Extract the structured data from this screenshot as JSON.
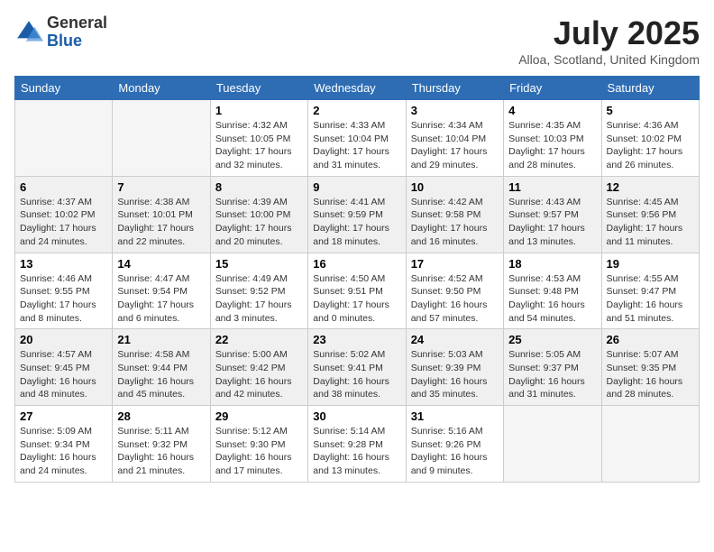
{
  "header": {
    "logo": {
      "general": "General",
      "blue": "Blue"
    },
    "title": "July 2025",
    "location": "Alloa, Scotland, United Kingdom"
  },
  "weekdays": [
    "Sunday",
    "Monday",
    "Tuesday",
    "Wednesday",
    "Thursday",
    "Friday",
    "Saturday"
  ],
  "weeks": [
    [
      {
        "day": "",
        "empty": true
      },
      {
        "day": "",
        "empty": true
      },
      {
        "day": "1",
        "sunrise": "4:32 AM",
        "sunset": "10:05 PM",
        "daylight": "17 hours and 32 minutes."
      },
      {
        "day": "2",
        "sunrise": "4:33 AM",
        "sunset": "10:04 PM",
        "daylight": "17 hours and 31 minutes."
      },
      {
        "day": "3",
        "sunrise": "4:34 AM",
        "sunset": "10:04 PM",
        "daylight": "17 hours and 29 minutes."
      },
      {
        "day": "4",
        "sunrise": "4:35 AM",
        "sunset": "10:03 PM",
        "daylight": "17 hours and 28 minutes."
      },
      {
        "day": "5",
        "sunrise": "4:36 AM",
        "sunset": "10:02 PM",
        "daylight": "17 hours and 26 minutes."
      }
    ],
    [
      {
        "day": "6",
        "sunrise": "4:37 AM",
        "sunset": "10:02 PM",
        "daylight": "17 hours and 24 minutes."
      },
      {
        "day": "7",
        "sunrise": "4:38 AM",
        "sunset": "10:01 PM",
        "daylight": "17 hours and 22 minutes."
      },
      {
        "day": "8",
        "sunrise": "4:39 AM",
        "sunset": "10:00 PM",
        "daylight": "17 hours and 20 minutes."
      },
      {
        "day": "9",
        "sunrise": "4:41 AM",
        "sunset": "9:59 PM",
        "daylight": "17 hours and 18 minutes."
      },
      {
        "day": "10",
        "sunrise": "4:42 AM",
        "sunset": "9:58 PM",
        "daylight": "17 hours and 16 minutes."
      },
      {
        "day": "11",
        "sunrise": "4:43 AM",
        "sunset": "9:57 PM",
        "daylight": "17 hours and 13 minutes."
      },
      {
        "day": "12",
        "sunrise": "4:45 AM",
        "sunset": "9:56 PM",
        "daylight": "17 hours and 11 minutes."
      }
    ],
    [
      {
        "day": "13",
        "sunrise": "4:46 AM",
        "sunset": "9:55 PM",
        "daylight": "17 hours and 8 minutes."
      },
      {
        "day": "14",
        "sunrise": "4:47 AM",
        "sunset": "9:54 PM",
        "daylight": "17 hours and 6 minutes."
      },
      {
        "day": "15",
        "sunrise": "4:49 AM",
        "sunset": "9:52 PM",
        "daylight": "17 hours and 3 minutes."
      },
      {
        "day": "16",
        "sunrise": "4:50 AM",
        "sunset": "9:51 PM",
        "daylight": "17 hours and 0 minutes."
      },
      {
        "day": "17",
        "sunrise": "4:52 AM",
        "sunset": "9:50 PM",
        "daylight": "16 hours and 57 minutes."
      },
      {
        "day": "18",
        "sunrise": "4:53 AM",
        "sunset": "9:48 PM",
        "daylight": "16 hours and 54 minutes."
      },
      {
        "day": "19",
        "sunrise": "4:55 AM",
        "sunset": "9:47 PM",
        "daylight": "16 hours and 51 minutes."
      }
    ],
    [
      {
        "day": "20",
        "sunrise": "4:57 AM",
        "sunset": "9:45 PM",
        "daylight": "16 hours and 48 minutes."
      },
      {
        "day": "21",
        "sunrise": "4:58 AM",
        "sunset": "9:44 PM",
        "daylight": "16 hours and 45 minutes."
      },
      {
        "day": "22",
        "sunrise": "5:00 AM",
        "sunset": "9:42 PM",
        "daylight": "16 hours and 42 minutes."
      },
      {
        "day": "23",
        "sunrise": "5:02 AM",
        "sunset": "9:41 PM",
        "daylight": "16 hours and 38 minutes."
      },
      {
        "day": "24",
        "sunrise": "5:03 AM",
        "sunset": "9:39 PM",
        "daylight": "16 hours and 35 minutes."
      },
      {
        "day": "25",
        "sunrise": "5:05 AM",
        "sunset": "9:37 PM",
        "daylight": "16 hours and 31 minutes."
      },
      {
        "day": "26",
        "sunrise": "5:07 AM",
        "sunset": "9:35 PM",
        "daylight": "16 hours and 28 minutes."
      }
    ],
    [
      {
        "day": "27",
        "sunrise": "5:09 AM",
        "sunset": "9:34 PM",
        "daylight": "16 hours and 24 minutes."
      },
      {
        "day": "28",
        "sunrise": "5:11 AM",
        "sunset": "9:32 PM",
        "daylight": "16 hours and 21 minutes."
      },
      {
        "day": "29",
        "sunrise": "5:12 AM",
        "sunset": "9:30 PM",
        "daylight": "16 hours and 17 minutes."
      },
      {
        "day": "30",
        "sunrise": "5:14 AM",
        "sunset": "9:28 PM",
        "daylight": "16 hours and 13 minutes."
      },
      {
        "day": "31",
        "sunrise": "5:16 AM",
        "sunset": "9:26 PM",
        "daylight": "16 hours and 9 minutes."
      },
      {
        "day": "",
        "empty": true
      },
      {
        "day": "",
        "empty": true
      }
    ]
  ]
}
